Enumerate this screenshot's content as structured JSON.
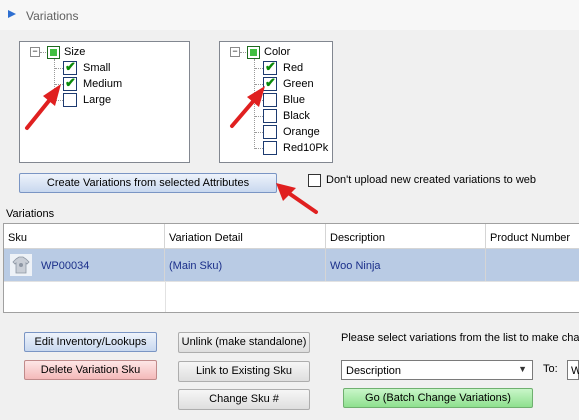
{
  "window": {
    "title": "Variations"
  },
  "attribute_trees": {
    "size": {
      "label": "Size",
      "expander": "−",
      "options": [
        {
          "label": "Small",
          "checked": true
        },
        {
          "label": "Medium",
          "checked": true
        },
        {
          "label": "Large",
          "checked": false
        }
      ]
    },
    "color": {
      "label": "Color",
      "expander": "−",
      "options": [
        {
          "label": "Red",
          "checked": true
        },
        {
          "label": "Green",
          "checked": true
        },
        {
          "label": "Blue",
          "checked": false
        },
        {
          "label": "Black",
          "checked": false
        },
        {
          "label": "Orange",
          "checked": false
        },
        {
          "label": "Red10Pk",
          "checked": false
        }
      ]
    },
    "check_glyph": "✔"
  },
  "create_button": {
    "label": "Create Variations from selected Attributes"
  },
  "dont_upload": {
    "label": "Don't upload new created variations to web",
    "checked": false
  },
  "variations": {
    "group_label": "Variations",
    "columns": [
      "Sku",
      "Variation Detail",
      "Description",
      "Product Number"
    ],
    "rows": [
      {
        "sku": "WP00034",
        "variation_detail": "(Main Sku)",
        "description": "Woo Ninja",
        "product_number": "",
        "icon": "tshirt-icon"
      }
    ]
  },
  "actions": {
    "edit_inventory": "Edit Inventory/Lookups",
    "delete_variation": "Delete Variation Sku",
    "unlink": "Unlink (make standalone)",
    "link_existing": "Link to Existing Sku",
    "change_sku": "Change Sku #"
  },
  "batch": {
    "instruction": "Please select variations from the list to make chang",
    "field_value": "Description",
    "to_label": "To:",
    "to_value": "W",
    "go_button": "Go (Batch Change Variations)"
  },
  "colors": {
    "accent_green": "#3fbf3f",
    "selection_row": "#b9cbe4",
    "arrow_red": "#e02020",
    "link_text": "#1b2f8a"
  }
}
